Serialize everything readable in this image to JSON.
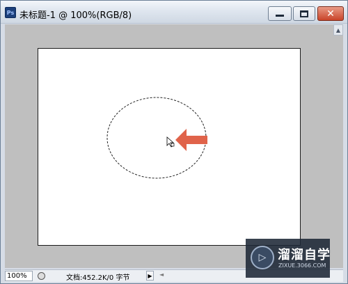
{
  "window": {
    "title": "未标题-1 @ 100%(RGB/8)",
    "app_icon": "Ps",
    "close_glyph": "✕"
  },
  "canvas": {
    "selection": "elliptical-marquee",
    "pointer_arrow_color": "#e0634a"
  },
  "statusbar": {
    "zoom": "100%",
    "doc_info": "文档:452.2K/0 字节",
    "menu_arrow": "▶",
    "scroll_arrow": "◄"
  },
  "watermark": {
    "logo_glyph": "▷",
    "title": "溜溜自学",
    "subtitle": "ZIXUE.3066.COM"
  }
}
